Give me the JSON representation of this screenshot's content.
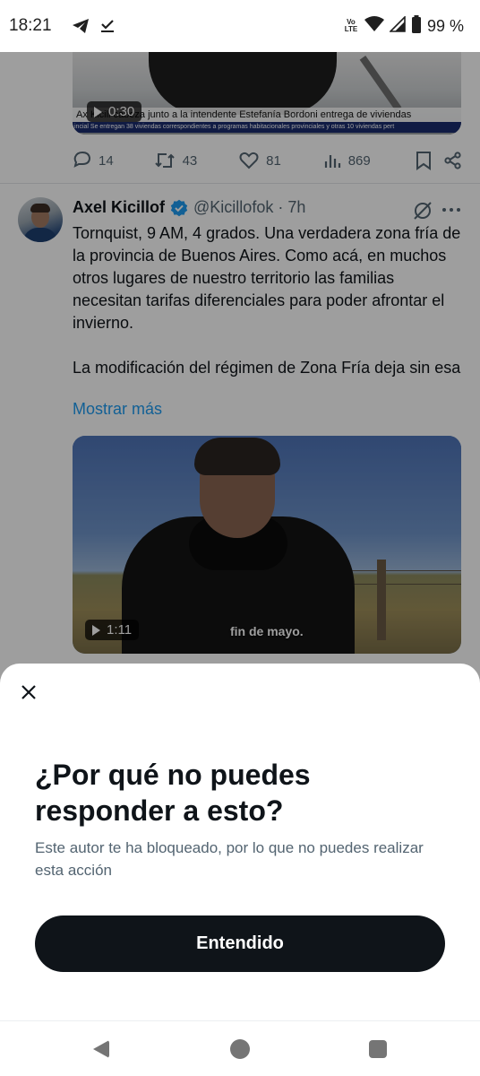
{
  "status_bar": {
    "time": "18:21",
    "left_icons": [
      "telegram-icon",
      "download-done-icon"
    ],
    "volte_top": "Vo",
    "volte_bottom": "LTE",
    "battery_text": "99 %"
  },
  "previous_tweet": {
    "video_duration": "0:30",
    "ticker_line1": "Ax  Kicill  cabeza junto a la intendente Estefanía Bordoni entrega de viviendas",
    "ticker_line2": "incial Se entregan 38 viviendas correspondientes a programas habitacionales provinciales y otras 10 viviendas pert",
    "actions": {
      "replies": "14",
      "reposts": "43",
      "likes": "81",
      "views": "869"
    }
  },
  "tweet": {
    "author_name": "Axel Kicillof",
    "handle_time": "@Kicillofok · 7h",
    "text_paragraph1": "Tornquist, 9 AM, 4 grados. Una verdadera zona fría de la provincia de Buenos Aires. Como acá, en muchos otros lugares de nuestro territorio las familias necesitan tarifas diferenciales para poder afrontar el invierno.",
    "text_paragraph2": "La modificación del régimen de Zona Fría deja sin esa",
    "show_more": "Mostrar más",
    "video_duration": "1:11",
    "video_subtitle": "fin de mayo."
  },
  "sheet": {
    "title": "¿Por qué no puedes responder a esto?",
    "description": "Este autor te ha bloqueado, por lo que no puedes realizar esta acción",
    "button_label": "Entendido"
  },
  "colors": {
    "accent_link": "#1d9bf0",
    "verified_badge": "#1d9bf0",
    "button_bg": "#0f1419",
    "secondary_text": "#536471"
  }
}
